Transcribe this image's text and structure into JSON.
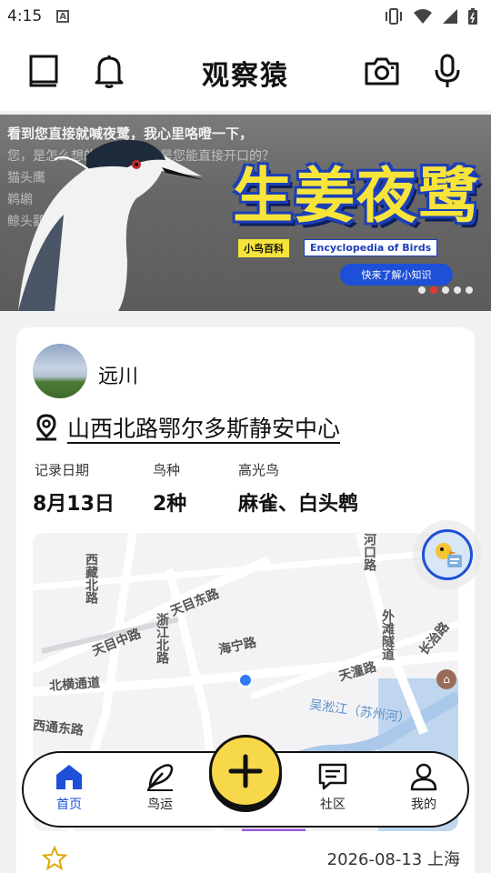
{
  "status_bar": {
    "time": "4:15",
    "notification_icon": "A"
  },
  "header": {
    "title": "观察猿"
  },
  "banner": {
    "headline": "看到您直接就喊夜鹭，我心里咯噔一下，",
    "background_text": "您，是怎么想的呢？夜鹭也是您能直接开口的？\n猫头鹰\n鹈鹕\n鲸头鹳",
    "title": "生姜夜鹭",
    "tag_cn": "小鸟百科",
    "tag_en": "Encyclopedia of Birds",
    "cta": "快来了解小知识",
    "slide_count": 5,
    "active_slide": 2
  },
  "record": {
    "username": "远川",
    "location": "山西北路鄂尔多斯静安中心",
    "stats": [
      {
        "label": "记录日期",
        "value": "8月13日"
      },
      {
        "label": "鸟种",
        "value": "2种"
      },
      {
        "label": "高光鸟",
        "value": "麻雀、白头鹎"
      }
    ],
    "map": {
      "labels": {
        "xizang": "西藏北路",
        "tianmu_east": "天目东路",
        "tianmu_mid": "天目中路",
        "zhejiang": "浙江北路",
        "haining": "海宁路",
        "beiheng": "北横通道",
        "tiantong": "天潼路",
        "waitan": "外滩隧道",
        "changzhi": "长治路",
        "wusong": "吴淞江（苏州河）",
        "xitong": "西通东路",
        "hekou": "河口路"
      }
    },
    "date_location": "2026-08-13 上海"
  },
  "bottom_nav": {
    "items": [
      {
        "label": "首页",
        "icon": "home-icon",
        "active": true
      },
      {
        "label": "鸟运",
        "icon": "feather-icon",
        "active": false
      },
      {
        "label": "社区",
        "icon": "chat-icon",
        "active": false
      },
      {
        "label": "我的",
        "icon": "profile-icon",
        "active": false
      }
    ],
    "add_icon": "plus-icon"
  },
  "colors": {
    "accent": "#1d4fd8",
    "yellow": "#f6d84a",
    "banner_title": "#f6e43a"
  }
}
